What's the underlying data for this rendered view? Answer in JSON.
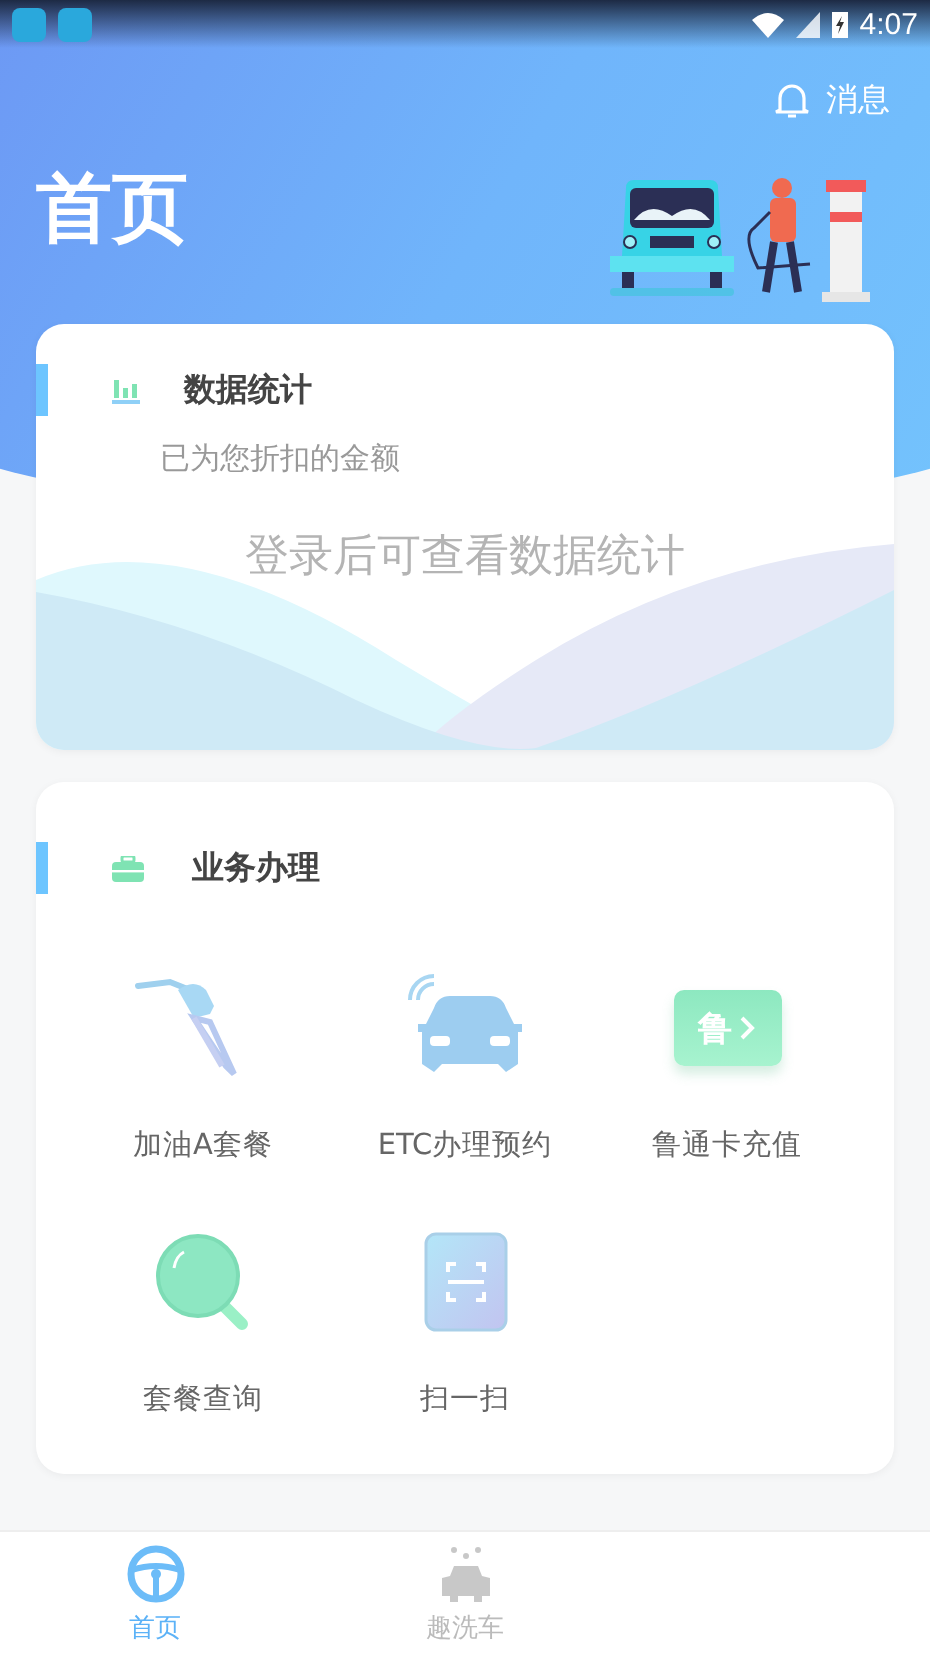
{
  "status_bar": {
    "time": "4:07"
  },
  "header": {
    "title": "首页",
    "messages_label": "消息"
  },
  "stats_card": {
    "title": "数据统计",
    "subtitle": "已为您折扣的金额",
    "empty_message": "登录后可查看数据统计"
  },
  "services_card": {
    "title": "业务办理",
    "items": [
      {
        "kind": "fuel",
        "label": "加油A套餐"
      },
      {
        "kind": "etc",
        "label": "ETC办理预约"
      },
      {
        "kind": "card",
        "label": "鲁通卡充值",
        "badge": "鲁"
      },
      {
        "kind": "search",
        "label": "套餐查询"
      },
      {
        "kind": "scan",
        "label": "扫一扫"
      }
    ]
  },
  "bottom_nav": [
    {
      "kind": "home",
      "label": "首页",
      "selected": true
    },
    {
      "kind": "wash",
      "label": "趣洗车",
      "selected": false
    }
  ]
}
